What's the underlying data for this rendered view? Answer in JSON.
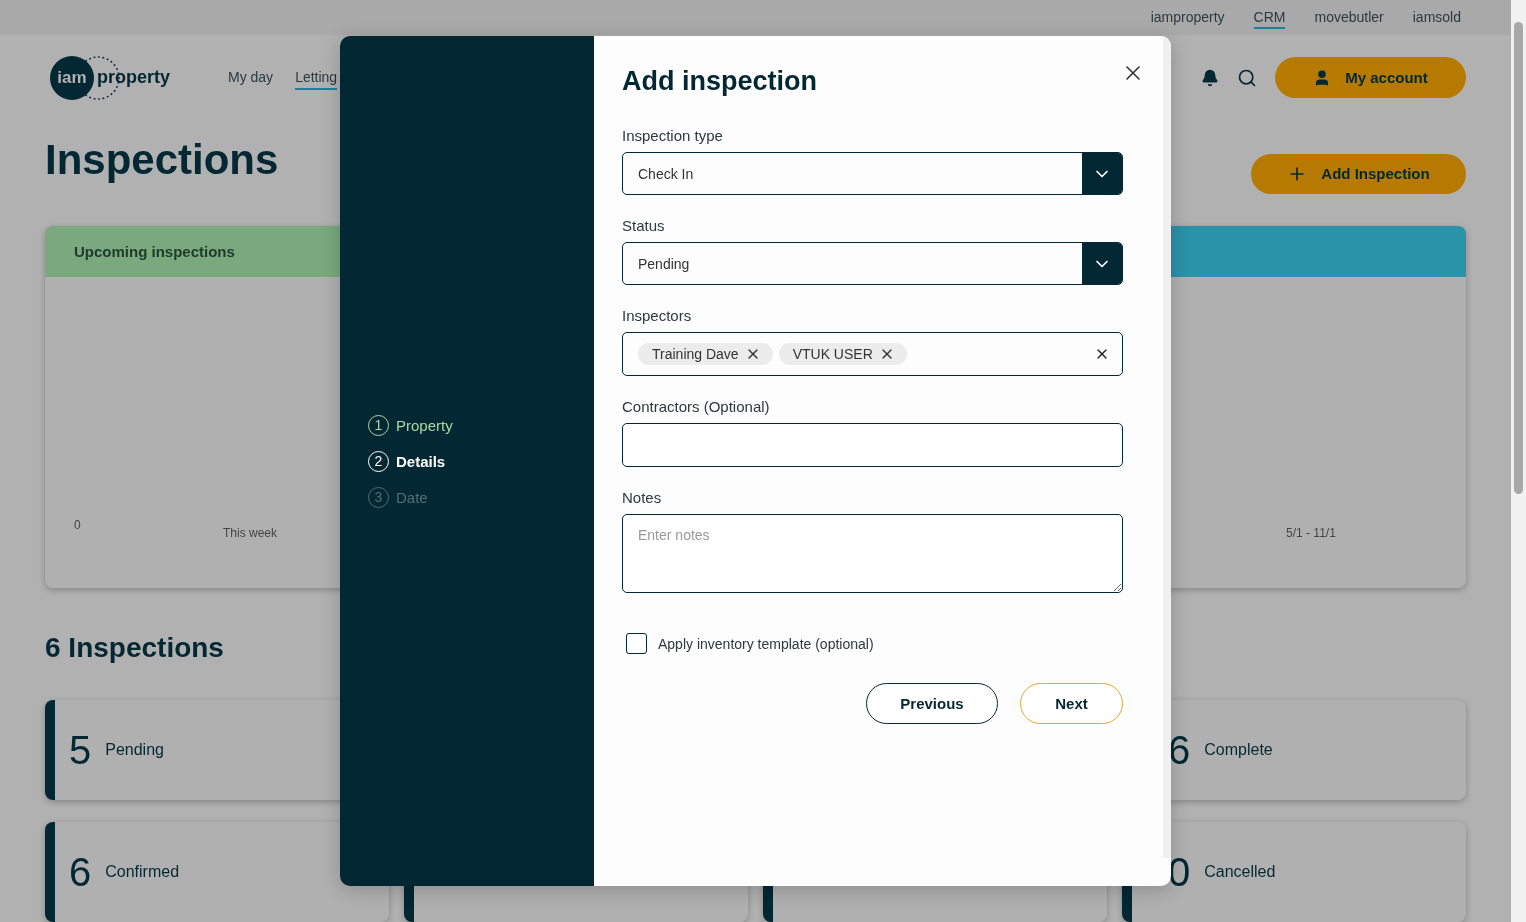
{
  "top_links": [
    {
      "label": "iamproperty",
      "selected": false
    },
    {
      "label": "CRM",
      "selected": true
    },
    {
      "label": "movebutler",
      "selected": false
    },
    {
      "label": "iamsold",
      "selected": false
    }
  ],
  "logo": {
    "mark": "iam",
    "word": "property"
  },
  "nav": [
    {
      "label": "My day",
      "selected": false
    },
    {
      "label": "Letting",
      "selected": true
    }
  ],
  "account_button": "My account",
  "page_title": "Inspections",
  "add_button": "Add Inspection",
  "chart_cards": [
    {
      "title": "Upcoming inspections",
      "color": "#79a97c",
      "axis_label": "0",
      "period": "This week"
    },
    {
      "color": "#2a92a9",
      "period": "5/1 - 11/1"
    }
  ],
  "summary_title": "6 Inspections",
  "status_cards": [
    {
      "kind": "stat",
      "count": "5",
      "label": "Pending"
    },
    {
      "kind": "spacer"
    },
    {
      "kind": "spacer"
    },
    {
      "kind": "stat",
      "count": "6",
      "label": "Complete"
    },
    {
      "kind": "stat",
      "count": "6",
      "label": "Confirmed"
    },
    {
      "kind": "covered"
    },
    {
      "kind": "covered"
    },
    {
      "kind": "stat",
      "count": "0",
      "label": "Cancelled"
    }
  ],
  "modal": {
    "title": "Add inspection",
    "steps": [
      {
        "number": "1",
        "label": "Property",
        "done": true,
        "selected": false
      },
      {
        "number": "2",
        "label": "Details",
        "done": false,
        "selected": true
      },
      {
        "number": "3",
        "label": "Date",
        "done": false,
        "selected": false
      }
    ],
    "fields": [
      {
        "kind": "select",
        "label": "Inspection type",
        "value": "Check In"
      },
      {
        "kind": "select",
        "label": "Status",
        "value": "Pending"
      },
      {
        "kind": "tags",
        "label": "Inspectors",
        "tags": [
          "Training Dave",
          "VTUK USER"
        ]
      },
      {
        "kind": "text",
        "label": "Contractors (Optional)"
      },
      {
        "kind": "textarea",
        "label": "Notes",
        "placeholder": "Enter notes"
      }
    ],
    "checkbox": {
      "label": "Apply inventory template (optional)",
      "checked": false
    },
    "buttons": [
      {
        "label": "Previous",
        "kind": "secondary"
      },
      {
        "label": "Next",
        "kind": "primary"
      }
    ]
  }
}
